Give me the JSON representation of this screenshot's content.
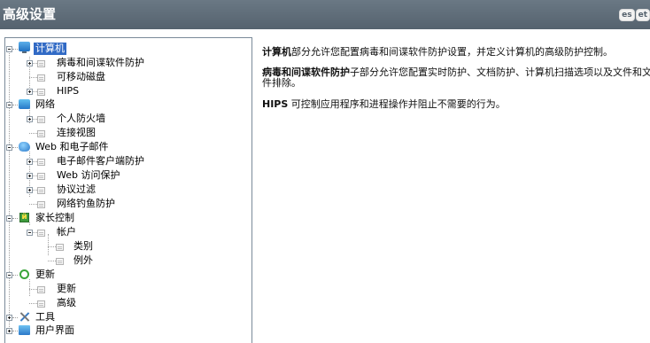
{
  "window": {
    "title": "高级设置",
    "logo": [
      "es",
      "et"
    ]
  },
  "tree": {
    "computer": {
      "label": "计算机",
      "children": [
        "病毒和间谍软件防护",
        "可移动磁盘",
        "HIPS"
      ]
    },
    "network": {
      "label": "网络",
      "children": [
        "个人防火墙",
        "连接视图"
      ]
    },
    "web_email": {
      "label": "Web 和电子邮件",
      "children": [
        "电子邮件客户端防护",
        "Web 访问保护",
        "协议过滤",
        "网络钓鱼防护"
      ]
    },
    "parental": {
      "label": "家长控制",
      "account": "帐户",
      "account_children": [
        "类别",
        "例外"
      ]
    },
    "update": {
      "label": "更新",
      "children": [
        "更新",
        "高级"
      ]
    },
    "tools": {
      "label": "工具"
    },
    "ui": {
      "label": "用户界面"
    }
  },
  "description": {
    "p1_bold": "计算机",
    "p1_rest": "部分允许您配置病毒和间谍软件防护设置，并定义计算机的高级防护控制。",
    "p2_bold": "病毒和间谍软件防护",
    "p2_rest": "子部分允许您配置实时防护、文档防护、计算机扫描选项以及文件和文件排除。",
    "p3_bold": "HIPS",
    "p3_rest": " 可控制应用程序和进程操作并阻止不需要的行为。"
  },
  "colors": {
    "titlebar": "#5d6a76",
    "selection": "#316ac5"
  }
}
